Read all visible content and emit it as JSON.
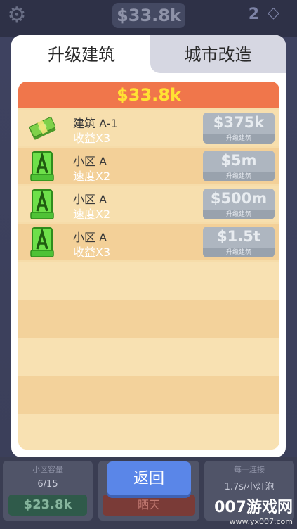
{
  "top_bar": {
    "money": "$33.8k",
    "gems": "2",
    "icons": {
      "settings": "gear-icon",
      "gem": "diamond-icon"
    }
  },
  "modal": {
    "tabs": [
      {
        "label": "升级建筑",
        "active": true
      },
      {
        "label": "城市改造",
        "active": false
      }
    ],
    "balance": "$33.8k",
    "upgrades": [
      {
        "icon": "cash-stack-icon",
        "title": "建筑 A-1",
        "effect": "收益X3",
        "price": "$375k",
        "button_caption": "升级建筑"
      },
      {
        "icon": "a-block-icon",
        "title": "小区 A",
        "effect": "速度X2",
        "price": "$5m",
        "button_caption": "升级建筑"
      },
      {
        "icon": "a-block-icon",
        "title": "小区 A",
        "effect": "速度X2",
        "price": "$500m",
        "button_caption": "升级建筑"
      },
      {
        "icon": "a-block-icon",
        "title": "小区 A",
        "effect": "收益X3",
        "price": "$1.5t",
        "button_caption": "升级建筑"
      }
    ],
    "back_label": "返回"
  },
  "bottom_cards": {
    "left": {
      "label": "小区容量",
      "value": "6/15",
      "money": "$23.8k"
    },
    "middle": {
      "button": "晒天"
    },
    "right": {
      "label": "每一连接",
      "value": "1.7s/小灯泡"
    }
  },
  "watermark": {
    "logo": "007游戏网",
    "url": "www.yx007.com"
  },
  "colors": {
    "header_bar": "#f0764b",
    "balance_text": "#ffe233",
    "back_button": "#5a86e8",
    "disabled_button": "#aeb6c0",
    "panel_light": "#f7dfae",
    "panel_dark": "#f3d098"
  }
}
